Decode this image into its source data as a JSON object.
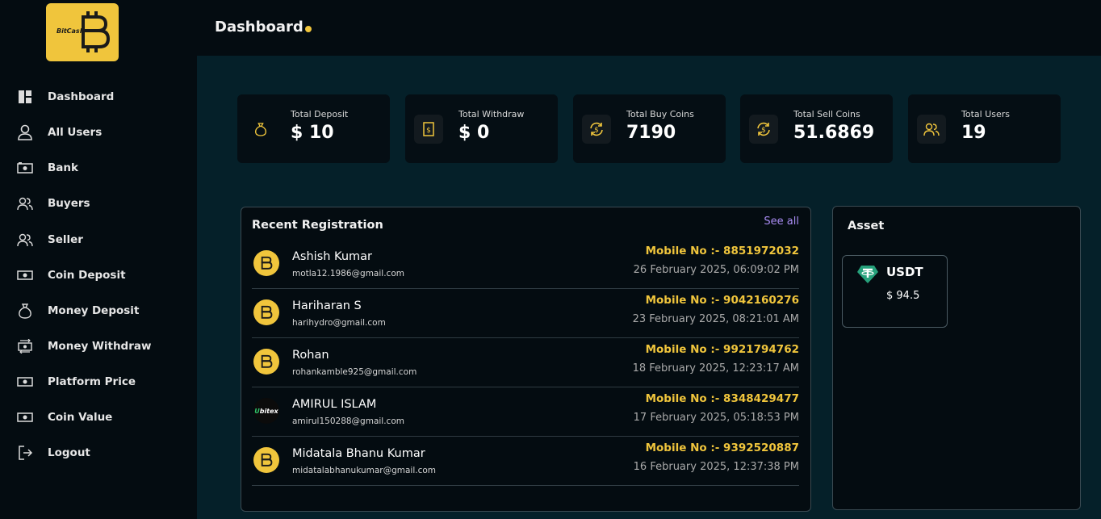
{
  "brand": {
    "logo_text": "BitCash",
    "color": "#f0c53c"
  },
  "header": {
    "title": "Dashboard"
  },
  "sidebar": {
    "items": [
      {
        "label": "Dashboard",
        "icon": "dashboard-icon"
      },
      {
        "label": "All Users",
        "icon": "user-icon"
      },
      {
        "label": "Bank",
        "icon": "money-icon"
      },
      {
        "label": "Buyers",
        "icon": "users-icon"
      },
      {
        "label": "Seller",
        "icon": "users-icon"
      },
      {
        "label": "Coin Deposit",
        "icon": "banknote-icon"
      },
      {
        "label": "Money Deposit",
        "icon": "money-bag-icon"
      },
      {
        "label": "Money Withdraw",
        "icon": "money-transfer-icon"
      },
      {
        "label": "Platform Price",
        "icon": "banknote-icon"
      },
      {
        "label": "Coin Value",
        "icon": "banknote-icon"
      },
      {
        "label": "Logout",
        "icon": "logout-icon"
      }
    ]
  },
  "stats": [
    {
      "label": "Total Deposit",
      "value": "$ 10",
      "icon": "money-bag-icon"
    },
    {
      "label": "Total Withdraw",
      "value": "$ 0",
      "icon": "receipt-icon"
    },
    {
      "label": "Total Buy Coins",
      "value": "7190",
      "icon": "exchange-icon"
    },
    {
      "label": "Total Sell Coins",
      "value": "51.6869",
      "icon": "exchange-icon"
    },
    {
      "label": "Total Users",
      "value": "19",
      "icon": "users-icon"
    }
  ],
  "recent": {
    "title": "Recent Registration",
    "see_all": "See all",
    "rows": [
      {
        "name": "Ashish Kumar",
        "email": "motla12.1986@gmail.com",
        "mobile": "Mobile No :- 8851972032",
        "date": "26 February 2025, 06:09:02 PM",
        "avatar": "bitcash-avatar"
      },
      {
        "name": "Hariharan S",
        "email": "harihydro@gmail.com",
        "mobile": "Mobile No :- 9042160276",
        "date": "23 February 2025, 08:21:01 AM",
        "avatar": "bitcash-avatar"
      },
      {
        "name": "Rohan",
        "email": "rohankamble925@gmail.com",
        "mobile": "Mobile No :- 9921794762",
        "date": "18 February 2025, 12:23:17 AM",
        "avatar": "bitcash-avatar"
      },
      {
        "name": "AMIRUL ISLAM",
        "email": "amirul150288@gmail.com",
        "mobile": "Mobile No :- 8348429477",
        "date": "17 February 2025, 05:18:53 PM",
        "avatar": "bitex-avatar",
        "avatar_text": "bitex"
      },
      {
        "name": "Midatala Bhanu Kumar",
        "email": "midatalabhanukumar@gmail.com",
        "mobile": "Mobile No :- 9392520887",
        "date": "16 February 2025, 12:37:38 PM",
        "avatar": "bitcash-avatar"
      }
    ]
  },
  "asset": {
    "title": "Asset",
    "items": [
      {
        "name": "USDT",
        "value": "$ 94.5",
        "icon": "tether-icon"
      }
    ]
  }
}
